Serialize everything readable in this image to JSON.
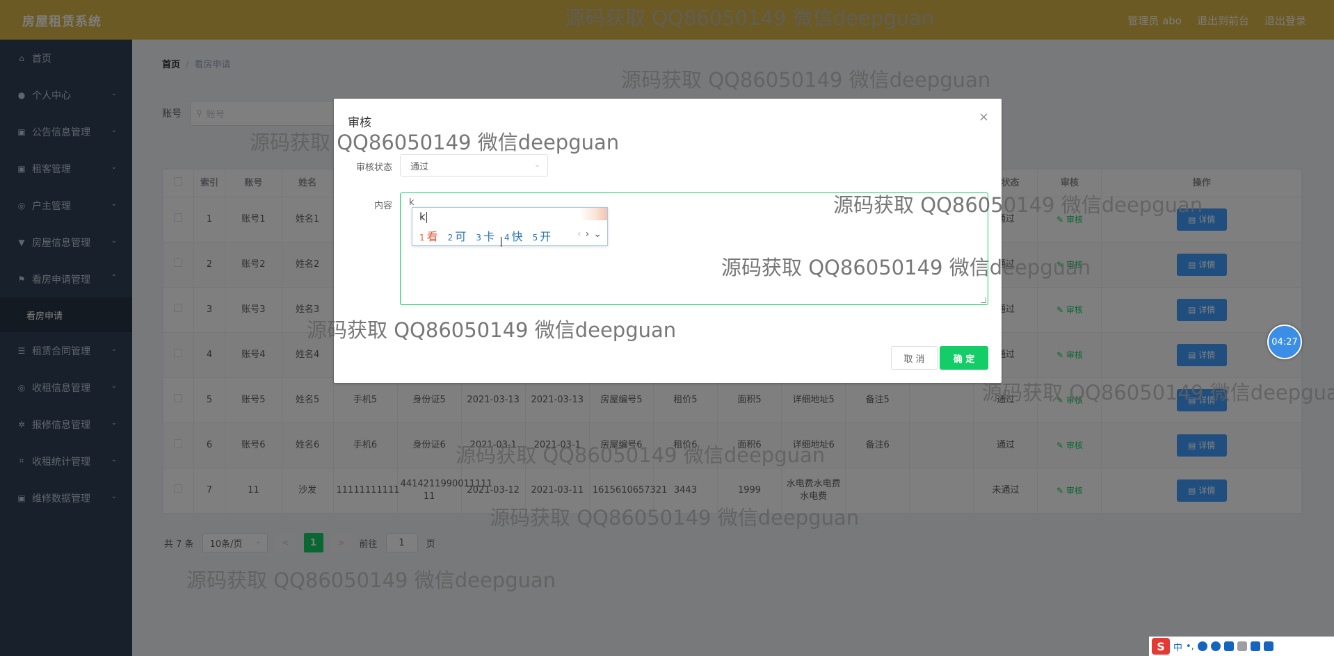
{
  "header": {
    "brand": "房屋租赁系统",
    "nav": [
      "管理员 abo",
      "退出到前台",
      "退出登录"
    ]
  },
  "sidebar": {
    "items": [
      {
        "label": "首页",
        "icon": "home-icon",
        "arrow": false
      },
      {
        "label": "个人中心",
        "icon": "user-icon",
        "arrow": true
      },
      {
        "label": "公告信息管理",
        "icon": "briefcase-icon",
        "arrow": true
      },
      {
        "label": "租客管理",
        "icon": "briefcase-icon",
        "arrow": true
      },
      {
        "label": "户主管理",
        "icon": "compass-icon",
        "arrow": true
      },
      {
        "label": "房屋信息管理",
        "icon": "tag-icon",
        "arrow": true
      },
      {
        "label": "看房申请管理",
        "icon": "flag-icon",
        "arrow": true
      }
    ],
    "sub_item": "看房申请",
    "items_after": [
      {
        "label": "租赁合同管理",
        "icon": "list-icon",
        "arrow": true
      },
      {
        "label": "收租信息管理",
        "icon": "compass-icon",
        "arrow": true
      },
      {
        "label": "报修信息管理",
        "icon": "help-icon",
        "arrow": true
      },
      {
        "label": "收租统计管理",
        "icon": "crop-icon",
        "arrow": true
      },
      {
        "label": "维修数据管理",
        "icon": "briefcase-icon",
        "arrow": true
      }
    ]
  },
  "breadcrumb": {
    "home": "首页",
    "sep": "/",
    "current": "看房申请"
  },
  "search": {
    "label": "账号",
    "placeholder": "账号"
  },
  "table": {
    "headers": [
      "",
      "索引",
      "账号",
      "姓名",
      "",
      "",
      "",
      "",
      "",
      "",
      "",
      "",
      "",
      "",
      "核状态",
      "审核",
      "操作"
    ],
    "rows": [
      {
        "cells": [
          "1",
          "账号1",
          "姓名1",
          "",
          "",
          "",
          "",
          "",
          "",
          "",
          "",
          "",
          "",
          "通过"
        ],
        "audit": "审核",
        "detail": "详情"
      },
      {
        "cells": [
          "2",
          "账号2",
          "姓名2",
          "",
          "",
          "",
          "",
          "",
          "",
          "",
          "",
          "",
          "",
          "通过"
        ],
        "audit": "审核",
        "detail": "详情"
      },
      {
        "cells": [
          "3",
          "账号3",
          "姓名3",
          "",
          "",
          "",
          "",
          "",
          "",
          "",
          "",
          "",
          "",
          "通过"
        ],
        "audit": "审核",
        "detail": "详情"
      },
      {
        "cells": [
          "4",
          "账号4",
          "姓名4",
          "",
          "",
          "",
          "",
          "",
          "",
          "",
          "",
          "",
          "",
          "通过"
        ],
        "audit": "审核",
        "detail": "详情"
      },
      {
        "cells": [
          "5",
          "账号5",
          "姓名5",
          "手机5",
          "身份证5",
          "2021-03-13",
          "2021-03-13",
          "房屋编号5",
          "租价5",
          "面积5",
          "详细地址5",
          "备注5",
          "",
          "通过"
        ],
        "audit": "审核",
        "detail": "详情"
      },
      {
        "cells": [
          "6",
          "账号6",
          "姓名6",
          "手机6",
          "身份证6",
          "2021-03-1",
          "2021-03-1",
          "房屋编号6",
          "租价6",
          "面积6",
          "详细地址6",
          "备注6",
          "",
          "通过"
        ],
        "audit": "审核",
        "detail": "详情"
      },
      {
        "cells": [
          "7",
          "11",
          "沙发",
          "11111111111",
          "4414211990011111 11",
          "2021-03-12",
          "2021-03-11",
          "1615610657321",
          "3443",
          "1999",
          "水电费水电费水电费",
          "",
          "",
          "未通过"
        ],
        "audit": "审核",
        "detail": "详情"
      }
    ]
  },
  "pager": {
    "total": "共 7 条",
    "size": "10条/页",
    "prev": "<",
    "current": "1",
    "next": ">",
    "goto_prefix": "前往",
    "goto_value": "1",
    "goto_suffix": "页"
  },
  "dialog": {
    "title": "审核",
    "close": "×",
    "status_label": "审核状态",
    "status_value": "通过",
    "content_label": "内容",
    "content_value": "k",
    "cancel": "取 消",
    "confirm": "确 定"
  },
  "ime": {
    "composition": "k",
    "candidates": [
      {
        "num": "1",
        "text": "看"
      },
      {
        "num": "2",
        "text": "可"
      },
      {
        "num": "3",
        "text": "卡"
      },
      {
        "num": "4",
        "text": "快"
      },
      {
        "num": "5",
        "text": "开"
      }
    ],
    "prev": "‹",
    "next": "›",
    "expand": "⌄"
  },
  "timer": "04:27",
  "tray": {
    "logo": "S",
    "lang": "中",
    "punct": "•,"
  },
  "watermark": "源码获取 QQ86050149 微信deepguan",
  "colors": {
    "header": "#d7b448",
    "sidebar": "#304156",
    "accent": "#13ce66",
    "primary": "#409eff"
  }
}
